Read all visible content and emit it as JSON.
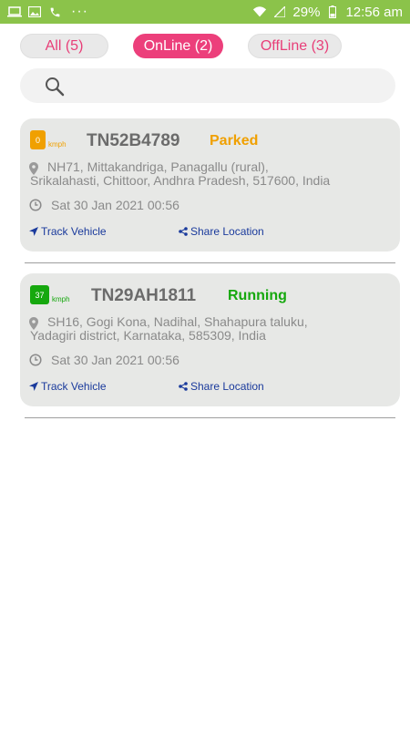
{
  "statusbar": {
    "battery": "29%",
    "time": "12:56 am",
    "dots": "···"
  },
  "tabs": [
    {
      "label": "All (5)"
    },
    {
      "label": "OnLine (2)"
    },
    {
      "label": "OffLine (3)"
    }
  ],
  "search": {
    "placeholder": ""
  },
  "vehicles": [
    {
      "speed": "0",
      "unit": "kmph",
      "plate": "TN52B4789",
      "status": "Parked",
      "status_color": "#f0a000",
      "address": "NH71, Mittakandriga, Panagallu (rural), Srikalahasti, Chittoor, Andhra Pradesh, 517600, India",
      "time": "Sat 30 Jan 2021 00:56",
      "track_label": "Track Vehicle",
      "share_label": "Share Location"
    },
    {
      "speed": "37",
      "unit": "kmph",
      "plate": "TN29AH1811",
      "status": "Running",
      "status_color": "#16a80e",
      "address": "SH16, Gogi Kona, Nadihal, Shahapura taluku, Yadagiri district, Karnataka, 585309, India",
      "time": "Sat 30 Jan 2021 00:56",
      "track_label": "Track Vehicle",
      "share_label": "Share Location"
    }
  ],
  "colors": {
    "accent": "#ec3f7b",
    "statusbar": "#8bc34a",
    "link": "#1a3a9c"
  }
}
